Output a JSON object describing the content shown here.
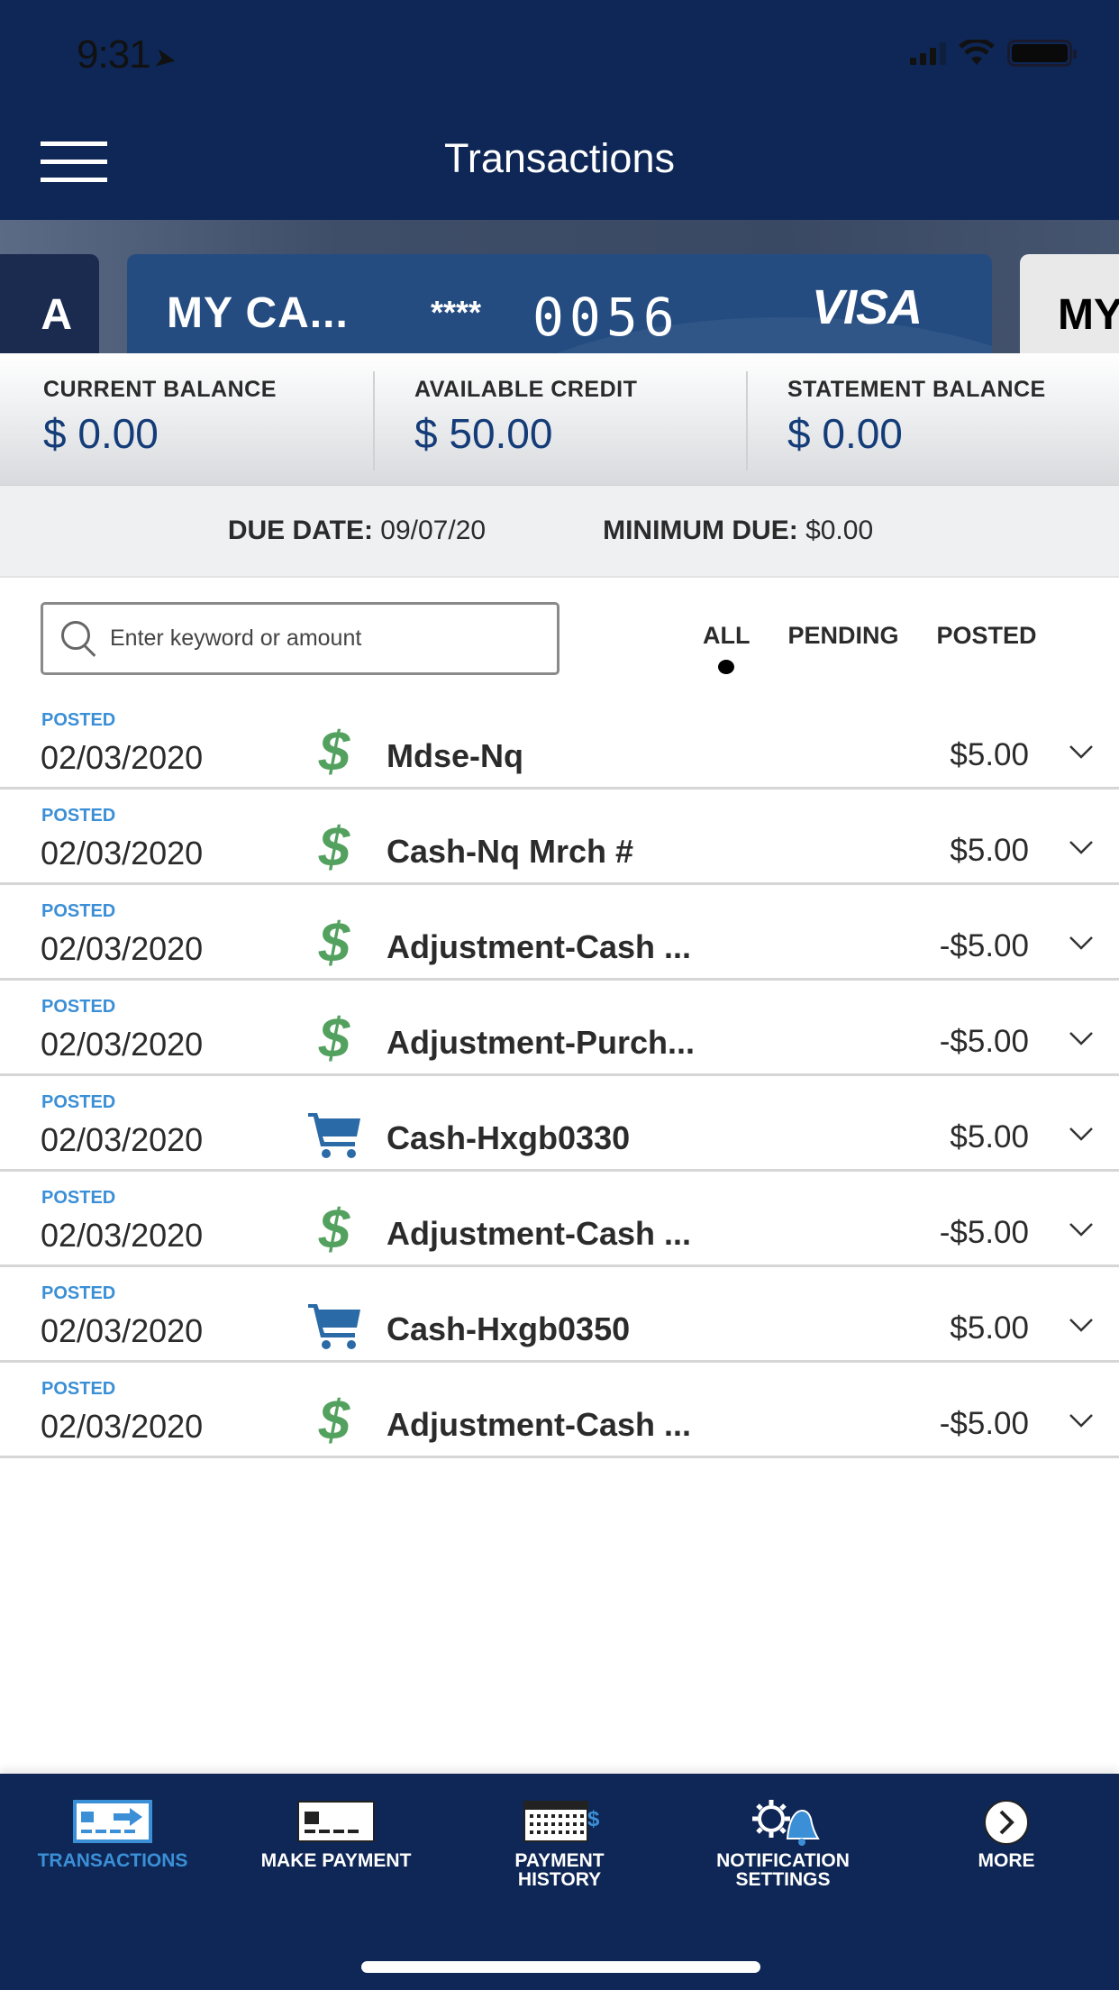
{
  "status_bar": {
    "time": "9:31"
  },
  "header": {
    "title": "Transactions"
  },
  "cards": {
    "prev_partial_label": "A",
    "current": {
      "name": "MY CA...",
      "mask": "****",
      "last4": "0056",
      "brand": "VISA"
    },
    "next_partial_label": "MY"
  },
  "balances": [
    {
      "label": "CURRENT BALANCE",
      "value": "$ 0.00"
    },
    {
      "label": "AVAILABLE CREDIT",
      "value": "$ 50.00"
    },
    {
      "label": "STATEMENT BALANCE",
      "value": "$ 0.00"
    }
  ],
  "due": {
    "due_date_label": "DUE DATE:",
    "due_date_value": "09/07/20",
    "minimum_due_label": "MINIMUM DUE:",
    "minimum_due_value": "$0.00"
  },
  "search": {
    "placeholder": "Enter keyword or amount",
    "value": ""
  },
  "filters": [
    {
      "label": "ALL",
      "active": true
    },
    {
      "label": "PENDING",
      "active": false
    },
    {
      "label": "POSTED",
      "active": false
    }
  ],
  "transactions": [
    {
      "status": "POSTED",
      "date": "02/03/2020",
      "icon": "dollar-icon",
      "description": "Mdse-Nq",
      "amount": "$5.00"
    },
    {
      "status": "POSTED",
      "date": "02/03/2020",
      "icon": "dollar-icon",
      "description": "Cash-Nq Mrch #",
      "amount": "$5.00"
    },
    {
      "status": "POSTED",
      "date": "02/03/2020",
      "icon": "dollar-icon",
      "description": "Adjustment-Cash ...",
      "amount": "-$5.00"
    },
    {
      "status": "POSTED",
      "date": "02/03/2020",
      "icon": "dollar-icon",
      "description": "Adjustment-Purch...",
      "amount": "-$5.00"
    },
    {
      "status": "POSTED",
      "date": "02/03/2020",
      "icon": "cart-icon",
      "description": "Cash-Hxgb0330",
      "amount": "$5.00"
    },
    {
      "status": "POSTED",
      "date": "02/03/2020",
      "icon": "dollar-icon",
      "description": "Adjustment-Cash ...",
      "amount": "-$5.00"
    },
    {
      "status": "POSTED",
      "date": "02/03/2020",
      "icon": "cart-icon",
      "description": "Cash-Hxgb0350",
      "amount": "$5.00"
    },
    {
      "status": "POSTED",
      "date": "02/03/2020",
      "icon": "dollar-icon",
      "description": "Adjustment-Cash ...",
      "amount": "-$5.00"
    }
  ],
  "bottom_nav": [
    {
      "line1": "TRANSACTIONS",
      "line2": "",
      "icon": "transactions-icon",
      "active": true
    },
    {
      "line1": "MAKE PAYMENT",
      "line2": "",
      "icon": "make-payment-icon",
      "active": false
    },
    {
      "line1": "PAYMENT",
      "line2": "HISTORY",
      "icon": "payment-history-icon",
      "active": false
    },
    {
      "line1": "NOTIFICATION",
      "line2": "SETTINGS",
      "icon": "notification-settings-icon",
      "active": false
    },
    {
      "line1": "MORE",
      "line2": "",
      "icon": "more-icon",
      "active": false
    }
  ],
  "colors": {
    "header_bg": "#0e2756",
    "card_bg": "#244c80",
    "balance_value": "#143c78",
    "accent_blue": "#3b8fd6",
    "dollar_green": "#53a15f",
    "cart_blue": "#2a6aa6"
  }
}
